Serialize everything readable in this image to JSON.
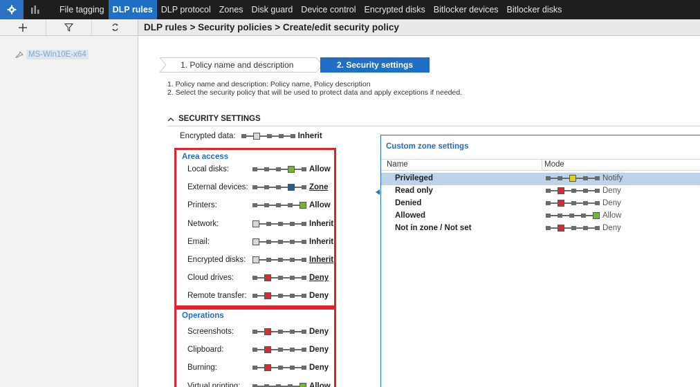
{
  "colors": {
    "yellow": "#e8cf1f",
    "red": "#d32f2f",
    "green": "#74b72e",
    "blue": "#1f5b9e",
    "gray": "#d8d8d8"
  },
  "menu": {
    "items": [
      "File tagging",
      "DLP rules",
      "DLP protocol",
      "Zones",
      "Disk guard",
      "Device control",
      "Encrypted disks",
      "Bitlocker devices",
      "Bitlocker disks"
    ],
    "active_index": 1,
    "settings_icon": "gear-icon",
    "stats_icon": "bar-chart-icon"
  },
  "toolbar": {
    "add_icon": "plus-icon",
    "filter_icon": "filter-icon",
    "refresh_icon": "refresh-icon"
  },
  "breadcrumb": "DLP rules > Security policies > Create/edit security policy",
  "tree": {
    "item_label": "MS-Win10E-x64",
    "item_icon": "pin-icon"
  },
  "wizard": {
    "step1": "1. Policy name and description",
    "step2": "2. Security settings"
  },
  "description": {
    "line1": "1. Policy name and description: Policy name, Policy description",
    "line2": "2. Select the security policy that will be used to protect data and apply exceptions if needed."
  },
  "section": {
    "title": "SECURITY SETTINGS",
    "toggle_icon": "chevron-up-icon"
  },
  "encrypted": {
    "label": "Encrypted data:",
    "value": "Inherit",
    "level": 2
  },
  "area_access": {
    "title": "Area access",
    "items": [
      {
        "label": "Local disks:",
        "value": "Allow",
        "level": 4,
        "color": "green",
        "link": false
      },
      {
        "label": "External devices:",
        "value": "Zone",
        "level": 4,
        "color": "blue",
        "link": true
      },
      {
        "label": "Printers:",
        "value": "Allow",
        "level": 5,
        "color": "green",
        "link": false
      },
      {
        "label": "Network:",
        "value": "Inherit",
        "level": 1,
        "color": "gray",
        "link": false
      },
      {
        "label": "Email:",
        "value": "Inherit",
        "level": 1,
        "color": "gray",
        "link": false
      },
      {
        "label": "Encrypted disks:",
        "value": "Inherit",
        "level": 1,
        "color": "gray",
        "link": true
      },
      {
        "label": "Cloud drives:",
        "value": "Deny",
        "level": 2,
        "color": "red",
        "link": true
      },
      {
        "label": "Remote transfer:",
        "value": "Deny",
        "level": 2,
        "color": "red",
        "link": false
      }
    ]
  },
  "operations": {
    "title": "Operations",
    "items": [
      {
        "label": "Screenshots:",
        "value": "Deny",
        "level": 2,
        "color": "red"
      },
      {
        "label": "Clipboard:",
        "value": "Deny",
        "level": 2,
        "color": "red"
      },
      {
        "label": "Burning:",
        "value": "Deny",
        "level": 2,
        "color": "red"
      },
      {
        "label": "Virtual printing:",
        "value": "Allow",
        "level": 5,
        "color": "green"
      }
    ]
  },
  "zones": {
    "title": "Custom zone settings",
    "col_name": "Name",
    "col_mode": "Mode",
    "rows": [
      {
        "name": "Privileged",
        "mode": "Notify",
        "level": 3,
        "color": "yellow",
        "selected": true
      },
      {
        "name": "Read only",
        "mode": "Deny",
        "level": 2,
        "color": "red",
        "selected": false
      },
      {
        "name": "Denied",
        "mode": "Deny",
        "level": 2,
        "color": "red",
        "selected": false
      },
      {
        "name": "Allowed",
        "mode": "Allow",
        "level": 5,
        "color": "green",
        "selected": false
      },
      {
        "name": "Not in zone / Not set",
        "mode": "Deny",
        "level": 2,
        "color": "red",
        "selected": false
      }
    ]
  }
}
